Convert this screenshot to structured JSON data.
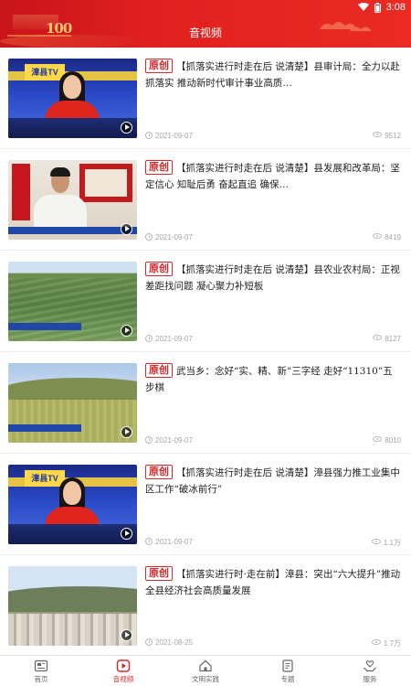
{
  "status_bar": {
    "time": "3:08"
  },
  "header": {
    "title": "音视频",
    "banner_text": "100"
  },
  "feed": [
    {
      "tag": "原创",
      "title": "【抓落实进行时走在后 说清楚】县审计局：全力以赴抓落实 推动新时代审计事业高质…",
      "date": "2021-09-07",
      "views": "9512",
      "thumbnail": "studio-anchor"
    },
    {
      "tag": "原创",
      "title": "【抓落实进行时走在后 说清楚】县发展和改革局：坚定信心 知耻后勇 奋起直追 确保…",
      "date": "2021-09-07",
      "views": "8419",
      "thumbnail": "office-interview"
    },
    {
      "tag": "原创",
      "title": "【抓落实进行时走在后 说清楚】县农业农村局：正视差距找问题 凝心聚力补短板",
      "date": "2021-09-07",
      "views": "8127",
      "thumbnail": "farmland"
    },
    {
      "tag": "原创",
      "title": "武当乡：念好“实、精、新”三字经 走好“11310”五步棋",
      "date": "2021-09-07",
      "views": "8010",
      "thumbnail": "hills"
    },
    {
      "tag": "原创",
      "title": "【抓落实进行时走在后 说清楚】漳县强力推工业集中区工作“破冰前行”",
      "date": "2021-09-07",
      "views": "1.1万",
      "thumbnail": "studio-anchor"
    },
    {
      "tag": "原创",
      "title": "【抓落实进行时·走在前】漳县：突出“六大提升”推动全县经济社会高质量发展",
      "date": "2021-08-25",
      "views": "1.7万",
      "thumbnail": "city-valley"
    }
  ],
  "nav": [
    {
      "label": "首页",
      "icon": "home-newspaper-icon",
      "active": false
    },
    {
      "label": "音视频",
      "icon": "play-video-icon",
      "active": true
    },
    {
      "label": "文明实践",
      "icon": "house-icon",
      "active": false
    },
    {
      "label": "专题",
      "icon": "topic-book-icon",
      "active": false
    },
    {
      "label": "服务",
      "icon": "service-hands-icon",
      "active": false
    }
  ],
  "colors": {
    "brand_red": "#d7282a",
    "header_red": "#e1211f",
    "meta_gray": "#a6a6a6"
  }
}
